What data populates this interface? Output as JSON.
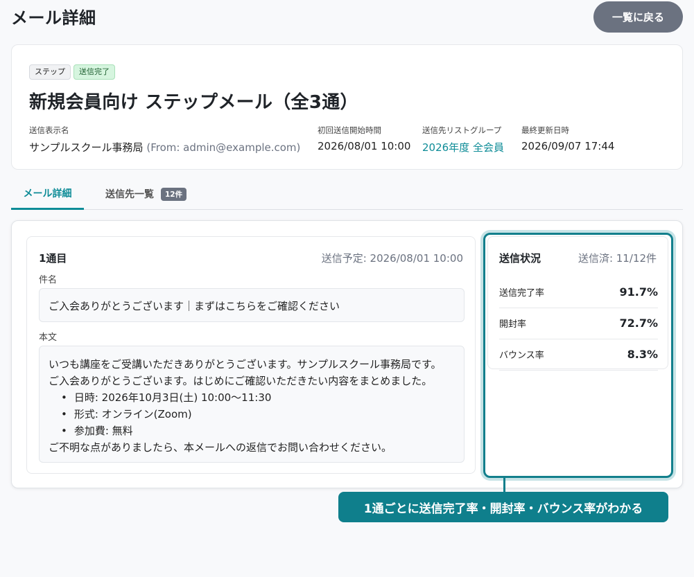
{
  "page": {
    "title": "メール詳細",
    "back_label": "一覧に戻る"
  },
  "mail": {
    "badges": [
      "ステップ",
      "送信完了"
    ],
    "title": "新規会員向け ステップメール（全3通）",
    "meta": {
      "sender_label": "送信表示名",
      "sender_name": "サンプルスクール事務局",
      "sender_email": "(From: admin@example.com)",
      "first_send_label": "初回送信開始時間",
      "first_send_value": "2026/08/01 10:00",
      "list_group_label": "送信先リストグループ",
      "list_group_value": "2026年度 全会員",
      "updated_label": "最終更新日時",
      "updated_value": "2026/09/07 17:44"
    }
  },
  "tabs": {
    "detail": "メール詳細",
    "recipients": "送信先一覧",
    "recipients_count": "12件"
  },
  "step": {
    "name": "1通目",
    "schedule": "送信予定: 2026/08/01 10:00",
    "subject_label": "件名",
    "subject": "ご入会ありがとうございます｜まずはこちらをご確認ください",
    "body_label": "本文",
    "body_line1": "いつも講座をご受講いただきありがとうございます。サンプルスクール事務局です。",
    "body_line2": "ご入会ありがとうございます。はじめにご確認いただきたい内容をまとめました。",
    "body_items": [
      "日時: 2026年10月3日(土) 10:00〜11:30",
      "形式: オンライン(Zoom)",
      "参加費: 無料"
    ],
    "body_line3": "ご不明な点がありましたら、本メールへの返信でお問い合わせください。"
  },
  "status": {
    "title": "送信状況",
    "count": "送信済: 11/12件",
    "rows": [
      {
        "label": "送信完了率",
        "value": "91.7%"
      },
      {
        "label": "開封率",
        "value": "72.7%"
      },
      {
        "label": "バウンス率",
        "value": "8.3%"
      }
    ]
  },
  "callout": "1通ごとに送信完了率・開封率・バウンス率がわかる",
  "colors": {
    "accent": "#0e8c97",
    "callout": "#0f7f8c",
    "back_button": "#6b7280"
  }
}
